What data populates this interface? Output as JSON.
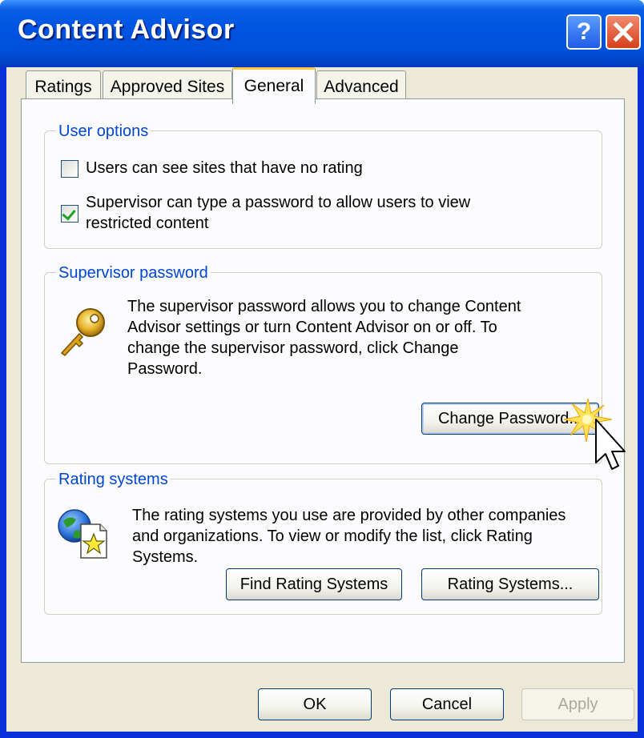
{
  "window": {
    "title": "Content Advisor"
  },
  "tabs": [
    {
      "label": "Ratings",
      "active": false
    },
    {
      "label": "Approved Sites",
      "active": false
    },
    {
      "label": "General",
      "active": true
    },
    {
      "label": "Advanced",
      "active": false
    }
  ],
  "user_options": {
    "legend": "User options",
    "option1": {
      "line1": "Users can see sites that have no rating",
      "checked": false
    },
    "option2": {
      "line1": "Supervisor can type a password to allow users to view",
      "line2": "restricted content",
      "checked": true
    }
  },
  "supervisor_password": {
    "legend": "Supervisor password",
    "lines": [
      "The supervisor password allows you to change Content",
      "Advisor settings or turn Content Advisor on or off. To",
      "change the supervisor password, click Change",
      "Password."
    ],
    "icon": "key-icon",
    "button": "Change Password..."
  },
  "rating_systems": {
    "legend": "Rating systems",
    "lines": [
      "The rating systems you use are provided by other companies",
      "and organizations. To view or modify the list, click Rating",
      "Systems."
    ],
    "icon": "globe-document-icon",
    "find_button": "Find Rating Systems",
    "systems_button": "Rating Systems..."
  },
  "footer": {
    "ok": "OK",
    "cancel": "Cancel",
    "apply": "Apply"
  },
  "colors": {
    "titlebar": "#0054e3",
    "legend_text": "#0046d5",
    "dialog_bg": "#ece9d8",
    "close_button": "#d6401c"
  }
}
